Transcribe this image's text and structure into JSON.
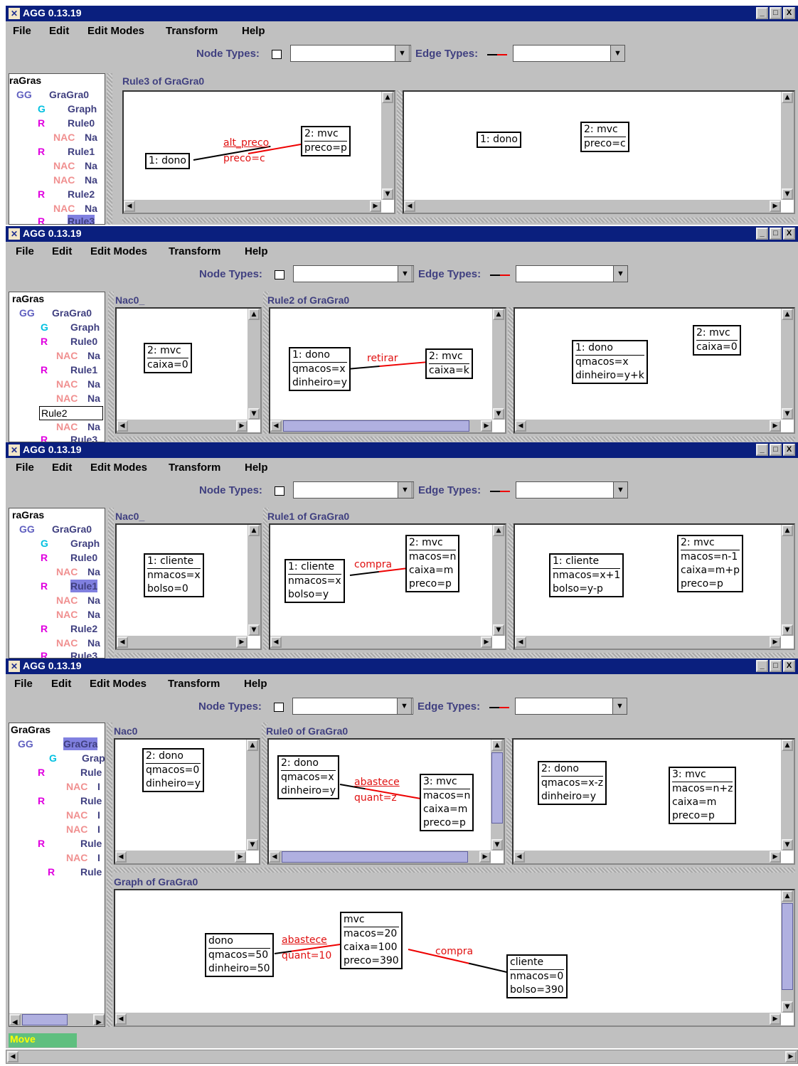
{
  "app": {
    "title": "AGG  0.13.19",
    "buttons": [
      "_",
      "□",
      "X"
    ]
  },
  "menu": [
    "File",
    "Edit",
    "Edit Modes",
    "Transform",
    "Help"
  ],
  "toolbar": {
    "node_types_label": "Node Types:",
    "edge_types_label": "Edge Types:"
  },
  "tree": {
    "w1": [
      "raGras",
      "GG",
      "GraGra0",
      "G",
      "Graph",
      "R",
      "Rule0",
      "NAC",
      "Na",
      "R",
      "Rule1",
      "NAC",
      "Na",
      "NAC",
      "Na",
      "R",
      "Rule2",
      "NAC",
      "Na",
      "R",
      "Rule3"
    ],
    "w2": [
      "raGras",
      "GG",
      "GraGra0",
      "G",
      "Graph",
      "R",
      "Rule0",
      "NAC",
      "Na",
      "R",
      "Rule1",
      "NAC",
      "Na",
      "NAC",
      "Na",
      "Rule2",
      "NAC",
      "Na",
      "R",
      "Rule3"
    ],
    "w3": [
      "raGras",
      "GG",
      "GraGra0",
      "G",
      "Graph",
      "R",
      "Rule0",
      "NAC",
      "Na",
      "R",
      "Rule1",
      "NAC",
      "Na",
      "NAC",
      "Na",
      "R",
      "Rule2",
      "NAC",
      "Na",
      "R",
      "Rule3"
    ],
    "w4": [
      "GraGras",
      "GG",
      "GraGra",
      "G",
      "Grap",
      "R",
      "Rule",
      "NAC",
      "I",
      "R",
      "Rule",
      "NAC",
      "I",
      "NAC",
      "I",
      "R",
      "Rule",
      "NAC",
      "I",
      "R",
      "Rule"
    ]
  },
  "w1": {
    "rule_head": "Rule3  of  GraGra0",
    "lhs": {
      "n1": [
        "1: dono"
      ],
      "n2": [
        "2: mvc",
        "preco=p"
      ],
      "edge": [
        "alt_preco",
        "preco=c"
      ]
    },
    "rhs": {
      "n1": [
        "1: dono"
      ],
      "n2": [
        "2: mvc",
        "preco=c"
      ]
    }
  },
  "w2": {
    "nac_head": "Nac0_",
    "rule_head": "Rule2  of  GraGra0",
    "nac": {
      "n1": [
        "2: mvc",
        "caixa=0"
      ]
    },
    "lhs": {
      "n1": [
        "1: dono",
        "qmacos=x",
        "dinheiro=y"
      ],
      "n2": [
        "2: mvc",
        "caixa=k"
      ],
      "edge": [
        "retirar"
      ]
    },
    "rhs": {
      "n1": [
        "1: dono",
        "qmacos=x",
        "dinheiro=y+k"
      ],
      "n2": [
        "2: mvc",
        "caixa=0"
      ]
    }
  },
  "w3": {
    "nac_head": "Nac0_",
    "rule_head": "Rule1  of  GraGra0",
    "nac": {
      "n1": [
        "1: cliente",
        "nmacos=x",
        "bolso=0"
      ]
    },
    "lhs": {
      "n1": [
        "1: cliente",
        "nmacos=x",
        "bolso=y"
      ],
      "n2": [
        "2: mvc",
        "macos=n",
        "caixa=m",
        "preco=p"
      ],
      "edge": [
        "compra"
      ]
    },
    "rhs": {
      "n1": [
        "1: cliente",
        "nmacos=x+1",
        "bolso=y-p"
      ],
      "n2": [
        "2: mvc",
        "macos=n-1",
        "caixa=m+p",
        "preco=p"
      ]
    }
  },
  "w4": {
    "nac_head": "Nac0",
    "rule_head": "Rule0  of  GraGra0",
    "graph_head": "Graph  of  GraGra0",
    "nac": {
      "n1": [
        "2: dono",
        "qmacos=0",
        "dinheiro=y"
      ]
    },
    "lhs": {
      "n1": [
        "2: dono",
        "qmacos=x",
        "dinheiro=y"
      ],
      "n2": [
        "3: mvc",
        "macos=n",
        "caixa=m",
        "preco=p"
      ],
      "edge": [
        "abastece",
        "quant=z"
      ]
    },
    "rhs": {
      "n1": [
        "2: dono",
        "qmacos=x-z",
        "dinheiro=y"
      ],
      "n2": [
        "3: mvc",
        "macos=n+z",
        "caixa=m",
        "preco=p"
      ]
    },
    "graph": {
      "dono": [
        "dono",
        "qmacos=50",
        "dinheiro=50"
      ],
      "mvc": [
        "mvc",
        "macos=20",
        "caixa=100",
        "preco=390"
      ],
      "cliente": [
        "cliente",
        "nmacos=0",
        "bolso=390"
      ],
      "e1": [
        "abastece",
        "quant=10"
      ],
      "e2": [
        "compra"
      ]
    }
  },
  "status": {
    "mode": "Move"
  }
}
